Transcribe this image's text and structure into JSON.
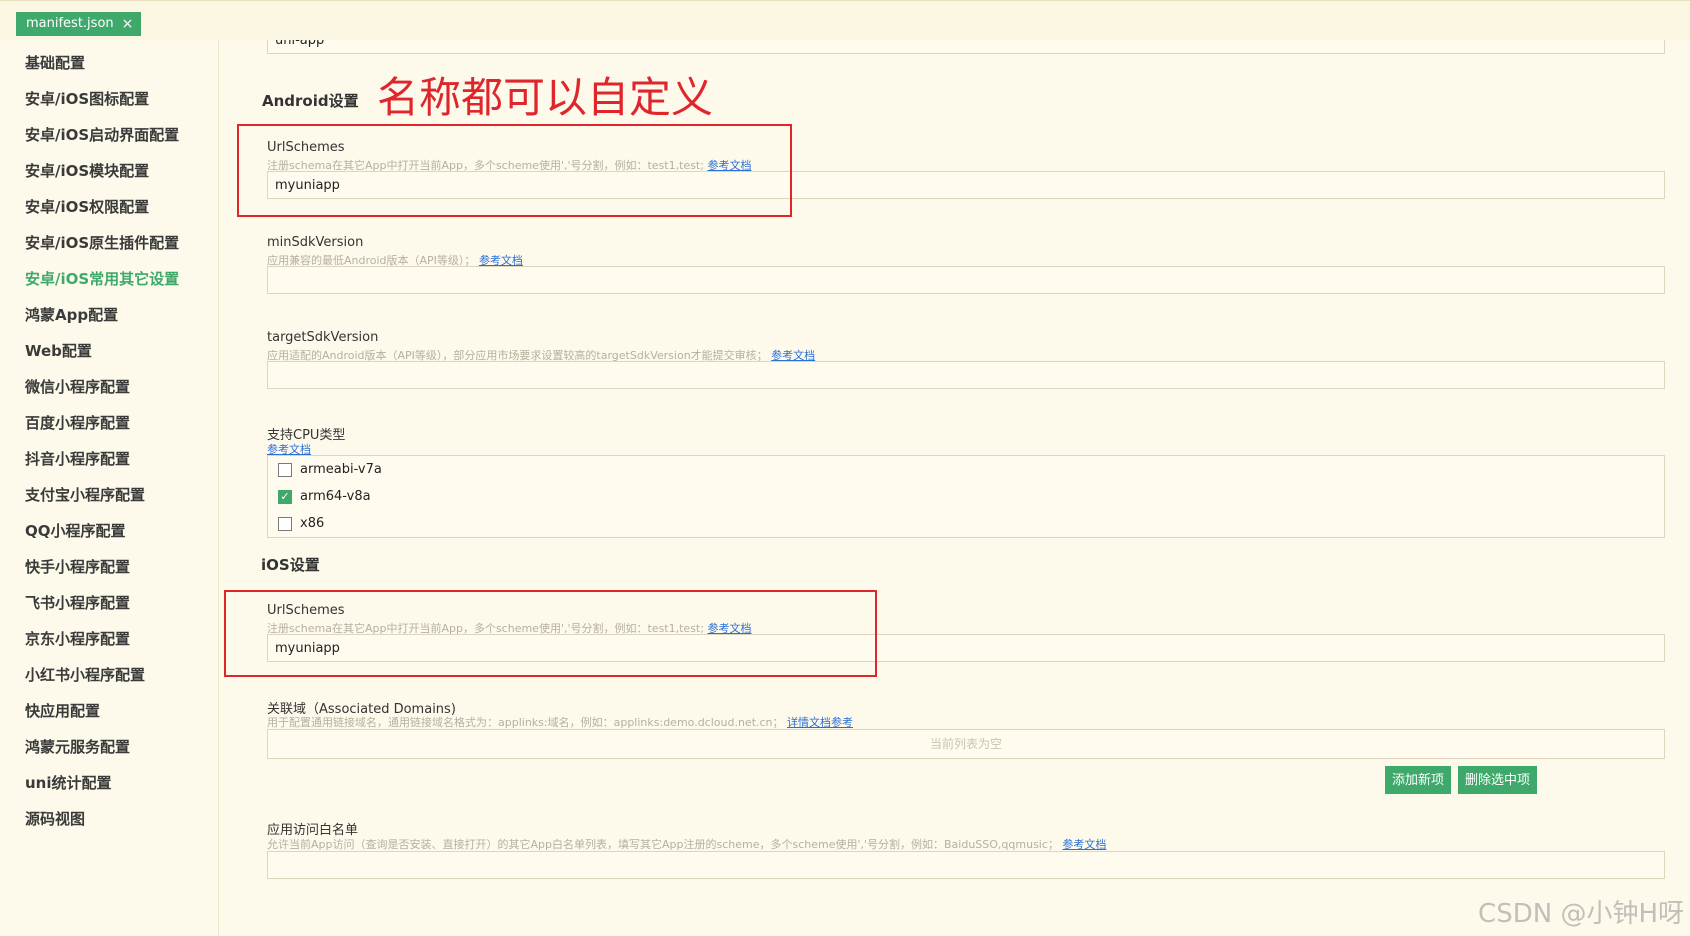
{
  "tab": {
    "label": "manifest.json",
    "close": "×"
  },
  "sidebar": {
    "items": [
      {
        "label": "基础配置"
      },
      {
        "label": "安卓/iOS图标配置"
      },
      {
        "label": "安卓/iOS启动界面配置"
      },
      {
        "label": "安卓/iOS模块配置"
      },
      {
        "label": "安卓/iOS权限配置"
      },
      {
        "label": "安卓/iOS原生插件配置"
      },
      {
        "label": "安卓/iOS常用其它设置",
        "active": true
      },
      {
        "label": "鸿蒙App配置"
      },
      {
        "label": "Web配置"
      },
      {
        "label": "微信小程序配置"
      },
      {
        "label": "百度小程序配置"
      },
      {
        "label": "抖音小程序配置"
      },
      {
        "label": "支付宝小程序配置"
      },
      {
        "label": "QQ小程序配置"
      },
      {
        "label": "快手小程序配置"
      },
      {
        "label": "飞书小程序配置"
      },
      {
        "label": "京东小程序配置"
      },
      {
        "label": "小红书小程序配置"
      },
      {
        "label": "快应用配置"
      },
      {
        "label": "鸿蒙元服务配置"
      },
      {
        "label": "uni统计配置"
      },
      {
        "label": "源码视图"
      }
    ]
  },
  "main": {
    "top_input_value": "uni-app",
    "annotation": "名称都可以自定义",
    "android": {
      "title": "Android设置",
      "url_schemes": {
        "label": "UrlSchemes",
        "desc": "注册schema在其它App中打开当前App，多个scheme使用','号分割，例如：test1,test;",
        "link": "参考文档",
        "value": "myuniapp"
      },
      "min_sdk": {
        "label": "minSdkVersion",
        "desc": "应用兼容的最低Android版本（API等级）；",
        "link": "参考文档",
        "value": ""
      },
      "target_sdk": {
        "label": "targetSdkVersion",
        "desc": "应用适配的Android版本（API等级），部分应用市场要求设置较高的targetSdkVersion才能提交审核；",
        "link": "参考文档",
        "value": ""
      },
      "cpu": {
        "label": "支持CPU类型",
        "link": "参考文档",
        "options": [
          {
            "label": "armeabi-v7a",
            "checked": false
          },
          {
            "label": "arm64-v8a",
            "checked": true
          },
          {
            "label": "x86",
            "checked": false
          }
        ]
      }
    },
    "ios": {
      "title": "iOS设置",
      "url_schemes": {
        "label": "UrlSchemes",
        "desc": "注册schema在其它App中打开当前App，多个scheme使用','号分割，例如：test1,test;",
        "link": "参考文档",
        "value": "myuniapp"
      },
      "associated_domains": {
        "label": "关联域（Associated Domains)",
        "desc": "用于配置通用链接域名，通用链接域名格式为：applinks:域名，例如：applinks:demo.dcloud.net.cn；",
        "link": "详情文档参考",
        "empty": "当前列表为空",
        "add_button": "添加新项",
        "delete_button": "删除选中项"
      },
      "whitelist": {
        "label": "应用访问白名单",
        "desc": "允许当前App访问（查询是否安装、直接打开）的其它App白名单列表，填写其它App注册的scheme，多个scheme使用','号分割，例如：BaiduSSO,qqmusic；",
        "link": "参考文档"
      }
    }
  },
  "watermark": "CSDN @小钟H呀"
}
